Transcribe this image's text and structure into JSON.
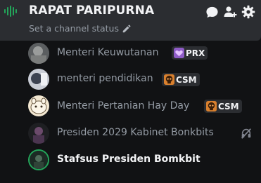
{
  "channel": {
    "name": "RAPAT PARIPURNA",
    "status_placeholder": "Set a channel status"
  },
  "members": [
    {
      "name": "Menteri Keuwutanan",
      "tag": "PRX",
      "tag_color": "#c58af9"
    },
    {
      "name": "menteri pendidikan",
      "tag": "CSM",
      "tag_color": "#f0a04b"
    },
    {
      "name": "Menteri Pertanian Hay Day",
      "tag": "CSM",
      "tag_color": "#f0a04b"
    },
    {
      "name": "Presiden 2029 Kabinet Bonkbits",
      "muted": true
    },
    {
      "name": "Stafsus Presiden Bomkbit",
      "speaking": true
    }
  ],
  "colors": {
    "speaking_ring": "#23a55a",
    "header_bg": "#2b2d31",
    "list_bg": "#111214"
  }
}
